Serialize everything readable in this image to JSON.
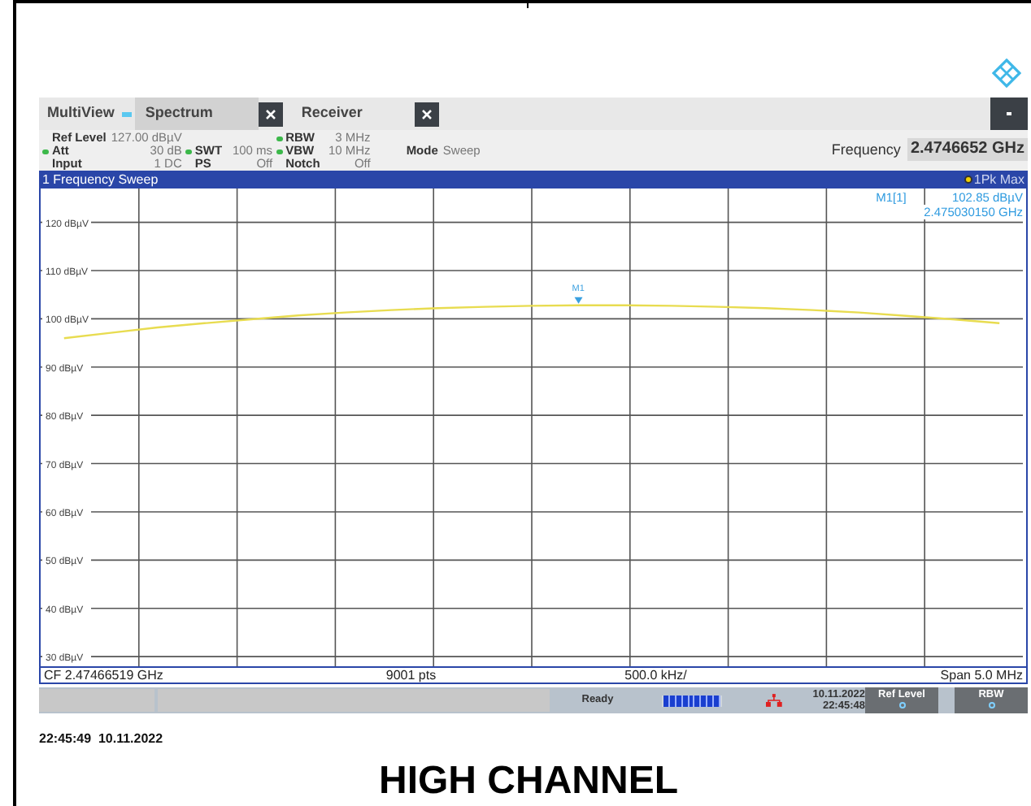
{
  "tabs": [
    {
      "label": "MultiView",
      "selected": false,
      "kind": "view"
    },
    {
      "label": "Spectrum",
      "selected": true,
      "kind": "closable"
    },
    {
      "label": "Receiver",
      "selected": false,
      "kind": "closable"
    }
  ],
  "settings": [
    {
      "items": [
        {
          "kind": "setting",
          "label": "Ref Level",
          "value": "127.00 dBµV",
          "indicator": false
        },
        {
          "kind": "setting",
          "label": "Att",
          "value": "30 dB",
          "indicator": true
        },
        {
          "kind": "setting",
          "label": "Input",
          "value": "1 DC",
          "indicator": false
        }
      ]
    },
    {
      "items": [
        {
          "kind": "blank"
        },
        {
          "kind": "setting",
          "label": "SWT",
          "value": "100 ms",
          "indicator": true
        },
        {
          "kind": "setting",
          "label": "PS",
          "value": "Off",
          "indicator": false
        }
      ]
    },
    {
      "items": [
        {
          "kind": "setting",
          "label": "RBW",
          "value": "3 MHz",
          "indicator": true
        },
        {
          "kind": "setting",
          "label": "VBW",
          "value": "10 MHz",
          "indicator": true
        },
        {
          "kind": "setting",
          "label": "Notch",
          "value": "Off",
          "indicator": false
        }
      ]
    },
    {
      "items": [
        {
          "kind": "blank"
        },
        {
          "kind": "setting",
          "label": "Mode",
          "value": "Sweep",
          "indicator": false
        }
      ]
    }
  ],
  "frequency": {
    "label": "Frequency",
    "value": "2.4746652 GHz"
  },
  "window_title": "1 Frequency Sweep",
  "marker_readout": {
    "name": "M1[1]",
    "amplitude": "102.85 dBµV",
    "frequency": "2.475030150 GHz"
  },
  "marker": {
    "label": "M1"
  },
  "chart_data": {
    "type": "line",
    "grid": true,
    "categories": [
      null,
      null,
      null,
      null,
      null,
      null,
      null,
      null,
      null,
      null,
      null,
      null,
      null,
      null,
      null,
      null,
      null,
      null,
      null,
      null,
      null
    ],
    "series": [
      {
        "name": "1Pk Max",
        "color": "#e8dc50",
        "values": [
          96.0,
          97.1,
          98.2,
          99.1,
          99.9,
          100.7,
          101.3,
          101.8,
          102.2,
          102.5,
          102.7,
          102.8,
          102.8,
          102.7,
          102.5,
          102.2,
          101.8,
          101.3,
          100.6,
          99.9,
          99.1
        ]
      }
    ],
    "ylim": [
      28,
      127
    ],
    "yticks": [
      {
        "value": 120,
        "label": "120 dBµV"
      },
      {
        "value": 110,
        "label": "110 dBµV"
      },
      {
        "value": 100,
        "label": "100 dBµV"
      },
      {
        "value": 90,
        "label": "90 dBµV"
      },
      {
        "value": 80,
        "label": "80 dBµV"
      },
      {
        "value": 70,
        "label": "70 dBµV"
      },
      {
        "value": 60,
        "label": "60 dBµV"
      },
      {
        "value": 50,
        "label": "50 dBµV"
      },
      {
        "value": 40,
        "label": "40 dBµV"
      },
      {
        "value": 30,
        "label": "30 dBµV"
      }
    ]
  },
  "footer": {
    "center_frequency": "CF 2.47466519 GHz",
    "points": "9001 pts",
    "per_division": "500.0 kHz/",
    "span": "Span 5.0 MHz"
  },
  "status": {
    "state": "Ready",
    "progress": {
      "level": 1
    },
    "date": "10.11.2022",
    "time": "22:45:48",
    "softkeys": [
      "Ref Level",
      "RBW"
    ]
  },
  "caption_timestamp": "22:45:49  10.11.2022",
  "caption": "HIGH CHANNEL"
}
